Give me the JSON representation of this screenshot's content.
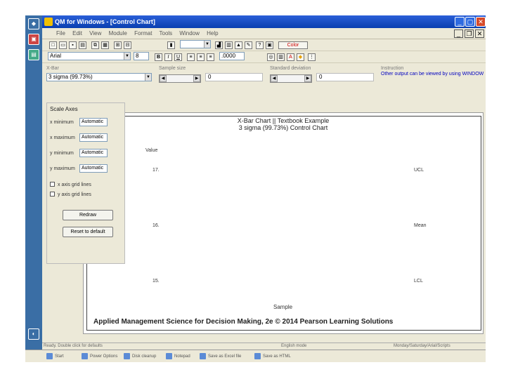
{
  "window": {
    "title": "QM for Windows - [Control Chart]"
  },
  "menu": [
    "File",
    "Edit",
    "View",
    "Module",
    "Format",
    "Tools",
    "Window",
    "Help"
  ],
  "toolbar": {
    "font": "Arial",
    "font_size": "8",
    "number_format": ".0000",
    "color_label": "Color"
  },
  "controls": {
    "xbar_label": "X-Bar",
    "sigma_select": "3 sigma (99.73%)",
    "left_group": "Sample size",
    "left_value": "0",
    "right_group": "Standard deviation",
    "right_value": "0",
    "instructions_label": "Instruction",
    "instructions_text": "Other output can be viewed by using WINDOW"
  },
  "chart": {
    "title": "X-Bar Chart || Textbook Example",
    "subtitle": "3 sigma (99.73%) Control Chart",
    "ylabel": "Value",
    "xlabel": "Sample",
    "ucl_label": "UCL",
    "mean_label": "Mean",
    "lcl_label": "LCL"
  },
  "chart_data": {
    "type": "line",
    "title": "X-Bar Chart || Textbook Example",
    "subtitle": "3 sigma (99.73%) Control Chart",
    "xlabel": "Sample",
    "ylabel": "Value",
    "ytick_labels": [
      "17.",
      "16.",
      "15."
    ],
    "reference_lines": [
      "UCL",
      "Mean",
      "LCL"
    ],
    "series": []
  },
  "footer": "Applied Management Science for Decision Making, 2e © 2014 Pearson Learning Solutions",
  "scale_axes": {
    "title": "Scale Axes",
    "rows": [
      {
        "label": "x minimum",
        "value": "Automatic"
      },
      {
        "label": "x maximum",
        "value": "Automatic"
      },
      {
        "label": "y minimum",
        "value": "Automatic"
      },
      {
        "label": "y maximum",
        "value": "Automatic"
      }
    ],
    "x_grid": "x axis grid lines",
    "y_grid": "y axis grid lines",
    "redraw": "Redraw",
    "reset": "Reset to default"
  },
  "status": {
    "left": "Ready. Double click for defaults",
    "mid": "English mode",
    "right": "Monday/Saturday/Arial/Scripts"
  },
  "taskbar": [
    "Start",
    "Power Options",
    "Disk cleanup",
    "Notepad",
    "Save as Excel file",
    "Save as HTML"
  ]
}
